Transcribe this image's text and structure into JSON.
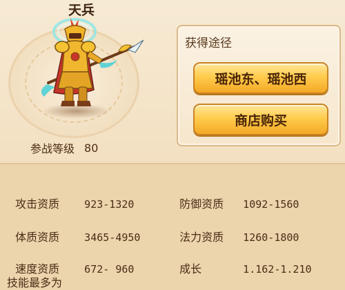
{
  "unit": {
    "name": "天兵",
    "level_label": "参战等级",
    "level_value": "80"
  },
  "acquire": {
    "title": "获得途径",
    "buttons": [
      "瑶池东、瑶池西",
      "商店购买"
    ]
  },
  "stats": {
    "attack": {
      "label": "攻击资质",
      "value": "923-1320"
    },
    "defense": {
      "label": "防御资质",
      "value": "1092-1560"
    },
    "physique": {
      "label": "体质资质",
      "value": "3465-4950"
    },
    "magic": {
      "label": "法力资质",
      "value": "1260-1800"
    },
    "speed": {
      "label": "速度资质",
      "value": "672- 960"
    },
    "growth": {
      "label": "成长",
      "value": "1.162-1.210"
    }
  },
  "skills_label": "技能最多为",
  "colors": {
    "button_gold": "#ffcc4d",
    "panel_border": "#d9b98a",
    "stats_bg": "#ecd4ad"
  },
  "icons": [
    "celestial-soldier-portrait"
  ]
}
